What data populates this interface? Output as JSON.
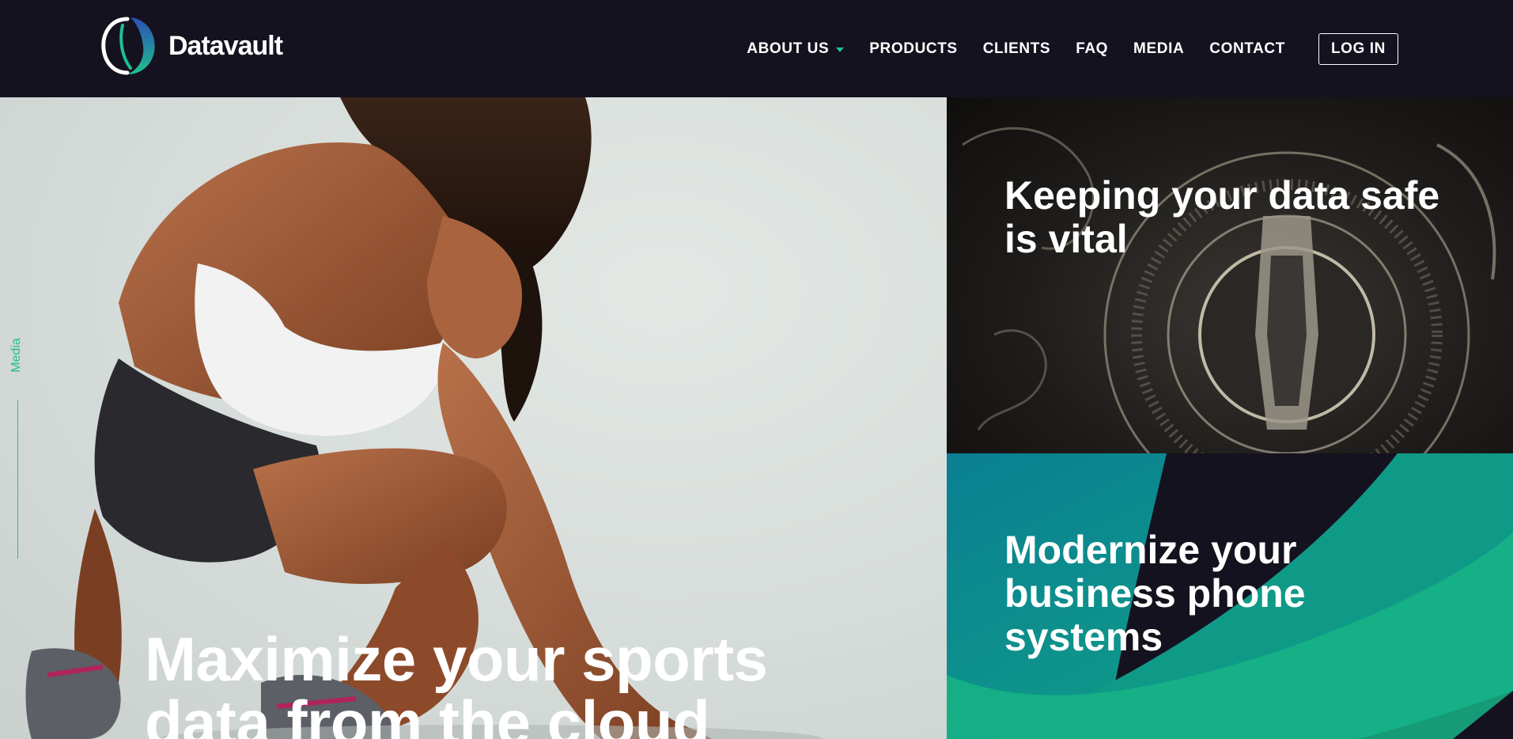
{
  "brand": {
    "name": "Datavault",
    "accent": "#1fc08f",
    "dark": "#15121f"
  },
  "nav": {
    "items": [
      {
        "label": "ABOUT US",
        "has_dropdown": true
      },
      {
        "label": "PRODUCTS"
      },
      {
        "label": "CLIENTS"
      },
      {
        "label": "FAQ"
      },
      {
        "label": "MEDIA"
      },
      {
        "label": "CONTACT"
      }
    ],
    "login_label": "LOG IN"
  },
  "hero": {
    "side_label": "Media",
    "title": "Maximize your sports data from the cloud"
  },
  "tiles": [
    {
      "title": "Keeping your data safe is vital"
    },
    {
      "title": "Modernize your business phone systems"
    }
  ]
}
